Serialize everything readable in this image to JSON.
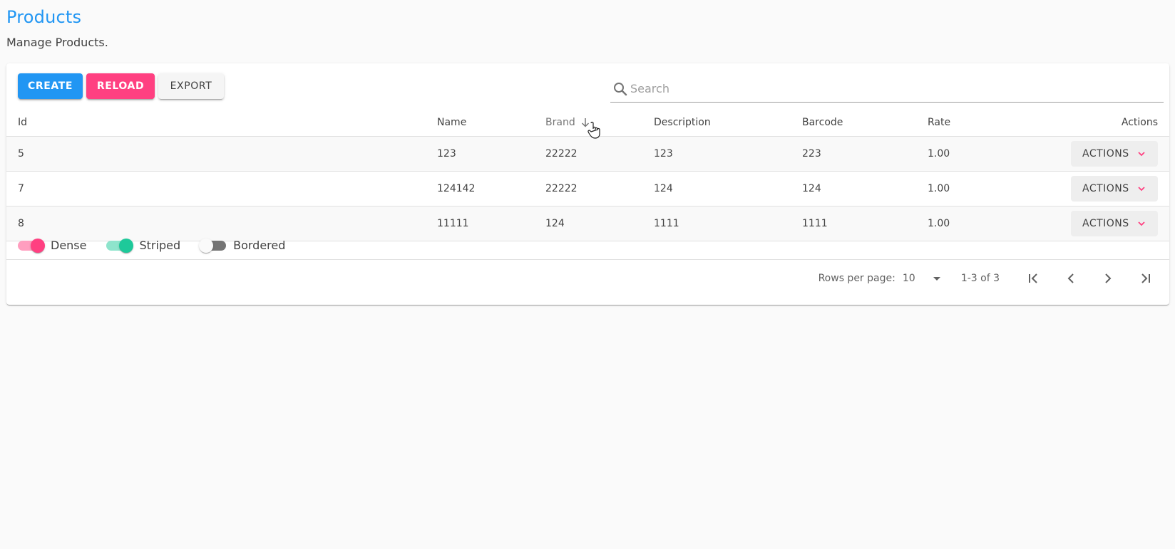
{
  "page": {
    "title": "Products",
    "subtitle": "Manage Products."
  },
  "toolbar": {
    "create_label": "CREATE",
    "reload_label": "RELOAD",
    "export_label": "EXPORT"
  },
  "search": {
    "placeholder": "Search",
    "value": ""
  },
  "table": {
    "headers": {
      "id": "Id",
      "name": "Name",
      "brand": "Brand",
      "description": "Description",
      "barcode": "Barcode",
      "rate": "Rate",
      "actions": "Actions"
    },
    "sort": {
      "column": "brand",
      "direction": "desc"
    },
    "rows": [
      {
        "id": "5",
        "name": "123",
        "brand": "22222",
        "description": "123",
        "barcode": "223",
        "rate": "1.00",
        "action_label": "ACTIONS"
      },
      {
        "id": "7",
        "name": "124142",
        "brand": "22222",
        "description": "124",
        "barcode": "124",
        "rate": "1.00",
        "action_label": "ACTIONS"
      },
      {
        "id": "8",
        "name": "11111",
        "brand": "124",
        "description": "1111",
        "barcode": "1111",
        "rate": "1.00",
        "action_label": "ACTIONS"
      }
    ]
  },
  "toggles": [
    {
      "label": "Dense",
      "on": true,
      "color": "#ff4081",
      "track_color": "#ff9ebf"
    },
    {
      "label": "Striped",
      "on": true,
      "color": "#1ec99a",
      "track_color": "#8ee4cc"
    },
    {
      "label": "Bordered",
      "on": false
    }
  ],
  "pagination": {
    "rows_per_page_label": "Rows per page:",
    "rows_per_page": "10",
    "range_text": "1-3 of 3"
  },
  "colors": {
    "primary": "#2196f3",
    "accent": "#ff4081",
    "teal": "#1ec99a"
  }
}
